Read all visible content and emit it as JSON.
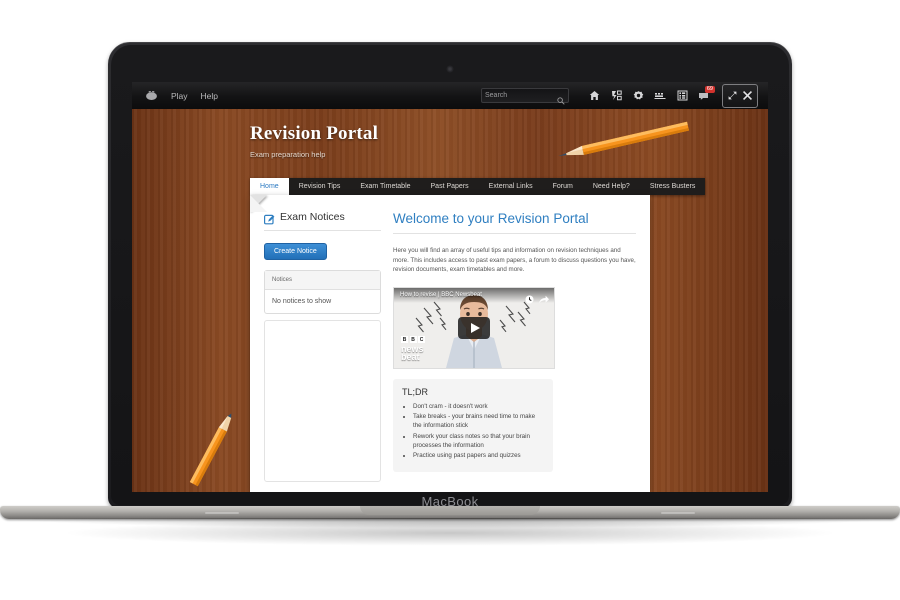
{
  "os": {
    "logo_icon": "apple-logo-icon",
    "menus": [
      "Play",
      "Help"
    ],
    "search": {
      "placeholder": "Search",
      "icon": "search-icon"
    },
    "icons": [
      {
        "name": "home-icon"
      },
      {
        "name": "shortcuts-icon"
      },
      {
        "name": "settings-gear-icon"
      },
      {
        "name": "keyboard-icon"
      },
      {
        "name": "apps-grid-icon"
      },
      {
        "name": "messages-icon",
        "badge": "69"
      }
    ],
    "window_buttons": [
      {
        "name": "fullscreen-icon"
      },
      {
        "name": "close-icon"
      }
    ]
  },
  "laptop": {
    "model_label": "MacBook"
  },
  "site": {
    "title": "Revision Portal",
    "subtitle": "Exam preparation help",
    "nav": [
      {
        "label": "Home",
        "active": true
      },
      {
        "label": "Revision Tips",
        "active": false
      },
      {
        "label": "Exam Timetable",
        "active": false
      },
      {
        "label": "Past Papers",
        "active": false
      },
      {
        "label": "External Links",
        "active": false
      },
      {
        "label": "Forum",
        "active": false
      },
      {
        "label": "Need Help?",
        "active": false
      },
      {
        "label": "Stress Busters",
        "active": false
      }
    ],
    "left_panel": {
      "heading": "Exam Notices",
      "heading_icon": "edit-note-icon",
      "create_button": "Create Notice",
      "notices_header": "Notices",
      "empty_text": "No notices to show"
    },
    "main": {
      "heading": "Welcome to your Revision Portal",
      "intro": "Here you will find an array of useful tips and information on revision techniques and more.  This includes access to past exam papers, a  forum to discuss questions you have, revision documents, exam timetables and more.",
      "video": {
        "title": "How to revise | BBC Newsbeat",
        "watch_later_icon": "clock-icon",
        "share_icon": "share-icon",
        "play_icon": "play-icon",
        "brand_marks": [
          "B",
          "B",
          "C"
        ],
        "brand_lines": [
          "news",
          "beat"
        ]
      },
      "tldr": {
        "heading": "TL;DR",
        "items": [
          "Don't cram - it doesn't work",
          "Take breaks - your brains need time to make the information stick",
          "Rework your class notes so that your brain processes the information",
          "Practice using past papers and quizzes"
        ]
      }
    },
    "decor": [
      {
        "name": "pencil-top-right"
      },
      {
        "name": "pencil-bottom-left"
      }
    ]
  },
  "colors": {
    "accent_blue": "#2f7fc1",
    "wood": "#8a4a24",
    "badge_red": "#d2322d"
  }
}
